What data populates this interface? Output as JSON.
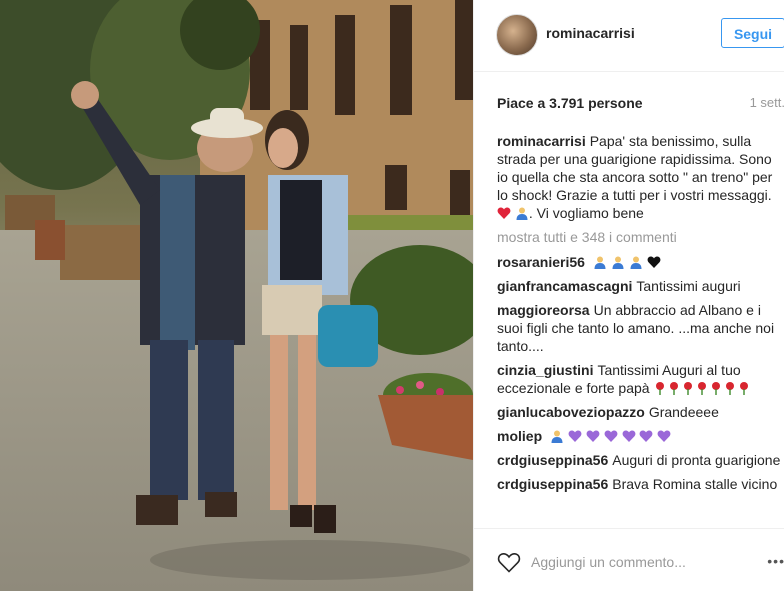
{
  "header": {
    "username": "rominacarrisi",
    "follow_label": "Segui"
  },
  "meta": {
    "likes": "Piace a 3.791 persone",
    "time": "1 sett."
  },
  "caption": {
    "user": "rominacarrisi",
    "text": "Papa' sta benissimo, sulla strada per una guarigione rapidissima. Sono io quella che sta ancora sotto \" an treno\" per lo shock! Grazie a tutti per i vostri messaggi.",
    "after": ". Vi vogliamo bene"
  },
  "view_all": "mostra tutti e 348 i commenti",
  "comments": [
    {
      "user": "rosaranieri56",
      "text": ""
    },
    {
      "user": "gianfrancamascagni",
      "text": "Tantissimi auguri"
    },
    {
      "user": "maggioreorsa",
      "text": "Un abbraccio ad Albano e i suoi figli che tanto lo amano. ...ma anche noi tanto...."
    },
    {
      "user": "cinzia_giustini",
      "text": "Tantissimi Auguri al tuo eccezionale e forte papà"
    },
    {
      "user": "gianlucaboveziopazzo",
      "text": "Grandeeee"
    },
    {
      "user": "moliep",
      "text": ""
    },
    {
      "user": "crdgiuseppina56",
      "text": "Auguri di pronta guarigione"
    },
    {
      "user": "crdgiuseppina56",
      "text": "Brava Romina stalle vicino"
    }
  ],
  "footer": {
    "placeholder": "Aggiungi un commento...",
    "more": "•••"
  },
  "icons": {
    "heart": "heart-icon",
    "more": "more-options-icon"
  },
  "colors": {
    "accent": "#3897f0",
    "secondary_text": "#999999",
    "purple_heart": "#9a68d8",
    "red_heart": "#e0243a"
  }
}
